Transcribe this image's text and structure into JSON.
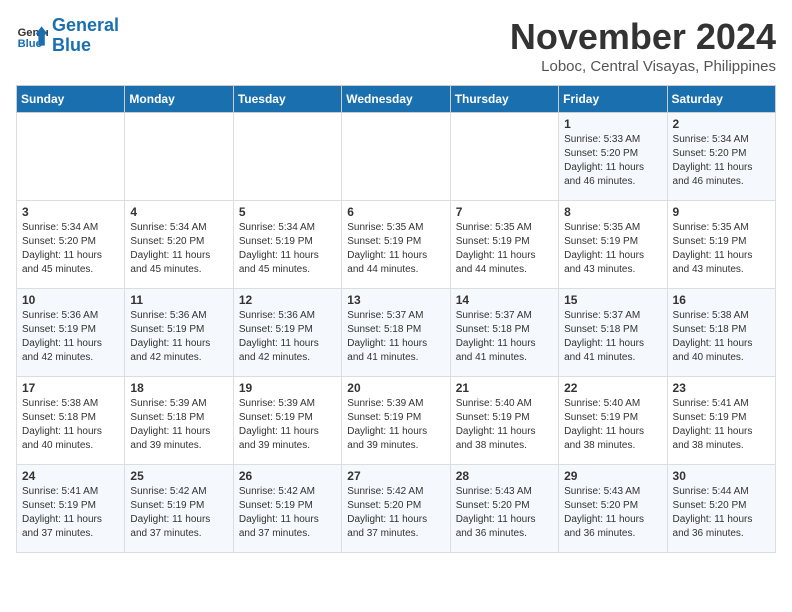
{
  "header": {
    "logo_line1": "General",
    "logo_line2": "Blue",
    "month_year": "November 2024",
    "location": "Loboc, Central Visayas, Philippines"
  },
  "weekdays": [
    "Sunday",
    "Monday",
    "Tuesday",
    "Wednesday",
    "Thursday",
    "Friday",
    "Saturday"
  ],
  "weeks": [
    [
      {
        "day": "",
        "info": ""
      },
      {
        "day": "",
        "info": ""
      },
      {
        "day": "",
        "info": ""
      },
      {
        "day": "",
        "info": ""
      },
      {
        "day": "",
        "info": ""
      },
      {
        "day": "1",
        "info": "Sunrise: 5:33 AM\nSunset: 5:20 PM\nDaylight: 11 hours\nand 46 minutes."
      },
      {
        "day": "2",
        "info": "Sunrise: 5:34 AM\nSunset: 5:20 PM\nDaylight: 11 hours\nand 46 minutes."
      }
    ],
    [
      {
        "day": "3",
        "info": "Sunrise: 5:34 AM\nSunset: 5:20 PM\nDaylight: 11 hours\nand 45 minutes."
      },
      {
        "day": "4",
        "info": "Sunrise: 5:34 AM\nSunset: 5:20 PM\nDaylight: 11 hours\nand 45 minutes."
      },
      {
        "day": "5",
        "info": "Sunrise: 5:34 AM\nSunset: 5:19 PM\nDaylight: 11 hours\nand 45 minutes."
      },
      {
        "day": "6",
        "info": "Sunrise: 5:35 AM\nSunset: 5:19 PM\nDaylight: 11 hours\nand 44 minutes."
      },
      {
        "day": "7",
        "info": "Sunrise: 5:35 AM\nSunset: 5:19 PM\nDaylight: 11 hours\nand 44 minutes."
      },
      {
        "day": "8",
        "info": "Sunrise: 5:35 AM\nSunset: 5:19 PM\nDaylight: 11 hours\nand 43 minutes."
      },
      {
        "day": "9",
        "info": "Sunrise: 5:35 AM\nSunset: 5:19 PM\nDaylight: 11 hours\nand 43 minutes."
      }
    ],
    [
      {
        "day": "10",
        "info": "Sunrise: 5:36 AM\nSunset: 5:19 PM\nDaylight: 11 hours\nand 42 minutes."
      },
      {
        "day": "11",
        "info": "Sunrise: 5:36 AM\nSunset: 5:19 PM\nDaylight: 11 hours\nand 42 minutes."
      },
      {
        "day": "12",
        "info": "Sunrise: 5:36 AM\nSunset: 5:19 PM\nDaylight: 11 hours\nand 42 minutes."
      },
      {
        "day": "13",
        "info": "Sunrise: 5:37 AM\nSunset: 5:18 PM\nDaylight: 11 hours\nand 41 minutes."
      },
      {
        "day": "14",
        "info": "Sunrise: 5:37 AM\nSunset: 5:18 PM\nDaylight: 11 hours\nand 41 minutes."
      },
      {
        "day": "15",
        "info": "Sunrise: 5:37 AM\nSunset: 5:18 PM\nDaylight: 11 hours\nand 41 minutes."
      },
      {
        "day": "16",
        "info": "Sunrise: 5:38 AM\nSunset: 5:18 PM\nDaylight: 11 hours\nand 40 minutes."
      }
    ],
    [
      {
        "day": "17",
        "info": "Sunrise: 5:38 AM\nSunset: 5:18 PM\nDaylight: 11 hours\nand 40 minutes."
      },
      {
        "day": "18",
        "info": "Sunrise: 5:39 AM\nSunset: 5:18 PM\nDaylight: 11 hours\nand 39 minutes."
      },
      {
        "day": "19",
        "info": "Sunrise: 5:39 AM\nSunset: 5:19 PM\nDaylight: 11 hours\nand 39 minutes."
      },
      {
        "day": "20",
        "info": "Sunrise: 5:39 AM\nSunset: 5:19 PM\nDaylight: 11 hours\nand 39 minutes."
      },
      {
        "day": "21",
        "info": "Sunrise: 5:40 AM\nSunset: 5:19 PM\nDaylight: 11 hours\nand 38 minutes."
      },
      {
        "day": "22",
        "info": "Sunrise: 5:40 AM\nSunset: 5:19 PM\nDaylight: 11 hours\nand 38 minutes."
      },
      {
        "day": "23",
        "info": "Sunrise: 5:41 AM\nSunset: 5:19 PM\nDaylight: 11 hours\nand 38 minutes."
      }
    ],
    [
      {
        "day": "24",
        "info": "Sunrise: 5:41 AM\nSunset: 5:19 PM\nDaylight: 11 hours\nand 37 minutes."
      },
      {
        "day": "25",
        "info": "Sunrise: 5:42 AM\nSunset: 5:19 PM\nDaylight: 11 hours\nand 37 minutes."
      },
      {
        "day": "26",
        "info": "Sunrise: 5:42 AM\nSunset: 5:19 PM\nDaylight: 11 hours\nand 37 minutes."
      },
      {
        "day": "27",
        "info": "Sunrise: 5:42 AM\nSunset: 5:20 PM\nDaylight: 11 hours\nand 37 minutes."
      },
      {
        "day": "28",
        "info": "Sunrise: 5:43 AM\nSunset: 5:20 PM\nDaylight: 11 hours\nand 36 minutes."
      },
      {
        "day": "29",
        "info": "Sunrise: 5:43 AM\nSunset: 5:20 PM\nDaylight: 11 hours\nand 36 minutes."
      },
      {
        "day": "30",
        "info": "Sunrise: 5:44 AM\nSunset: 5:20 PM\nDaylight: 11 hours\nand 36 minutes."
      }
    ]
  ]
}
